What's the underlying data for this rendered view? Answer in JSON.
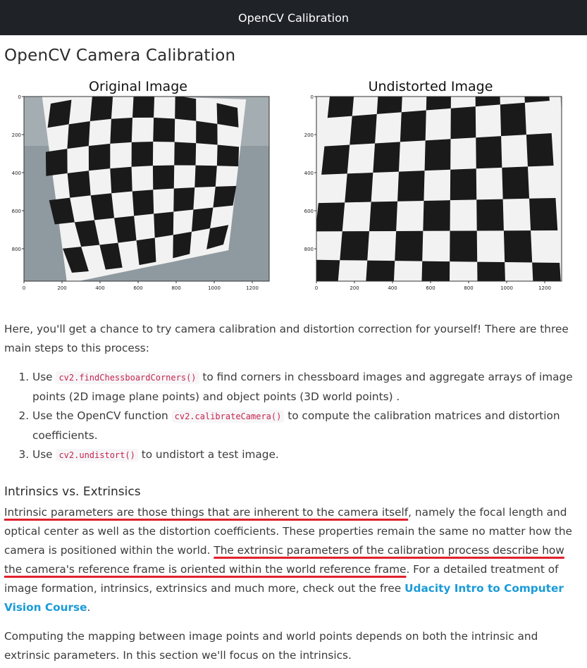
{
  "topbar": {
    "title": "OpenCV Calibration"
  },
  "page": {
    "heading": "OpenCV Camera Calibration"
  },
  "figures": {
    "left": {
      "title": "Original Image",
      "y_ticks": [
        "0",
        "200",
        "400",
        "600",
        "800"
      ],
      "x_ticks": [
        "0",
        "200",
        "400",
        "600",
        "800",
        "1000",
        "1200"
      ]
    },
    "right": {
      "title": "Undistorted Image",
      "y_ticks": [
        "0",
        "200",
        "400",
        "600",
        "800"
      ],
      "x_ticks": [
        "0",
        "200",
        "400",
        "600",
        "800",
        "1000",
        "1200"
      ]
    }
  },
  "intro": {
    "text": "Here, you'll get a chance to try camera calibration and distortion correction for yourself! There are three main steps to this process:"
  },
  "steps": [
    {
      "before": "Use ",
      "code": "cv2.findChessboardCorners()",
      "after": " to find corners in chessboard images and aggregate arrays of image points (2D image plane points) and object points (3D world points) ."
    },
    {
      "before": "Use the OpenCV function ",
      "code": "cv2.calibrateCamera()",
      "after": " to compute the calibration matrices and distortion coefficients."
    },
    {
      "before": "Use ",
      "code": "cv2.undistort()",
      "after": " to undistort a test image."
    }
  ],
  "section": {
    "heading": "Intrinsics vs. Extrinsics",
    "p1_underlined_1": "Intrinsic parameters are those things that are inherent to the camera itself",
    "p1_part_2": ", namely the focal length and optical center as well as the distortion coefficients. These properties remain the same no matter how the camera is positioned within the world. ",
    "p1_underlined_2": "The extrinsic parameters of the calibration process describe how the camera's reference frame is oriented within the world reference frame",
    "p1_part_3": ". For a detailed treatment of image formation, intrinsics, extrinsics and much more, check out the free ",
    "link_text": "Udacity Intro to Computer Vision Course",
    "p1_end": ".",
    "p2": "Computing the mapping between image points and world points depends on both the intrinsic and extrinsic parameters. In this section we'll focus on the intrinsics."
  },
  "colors": {
    "topbar_bg": "#1f2227",
    "underline": "#e0222c",
    "link": "#1a9bd7",
    "code": "#c7254e"
  }
}
